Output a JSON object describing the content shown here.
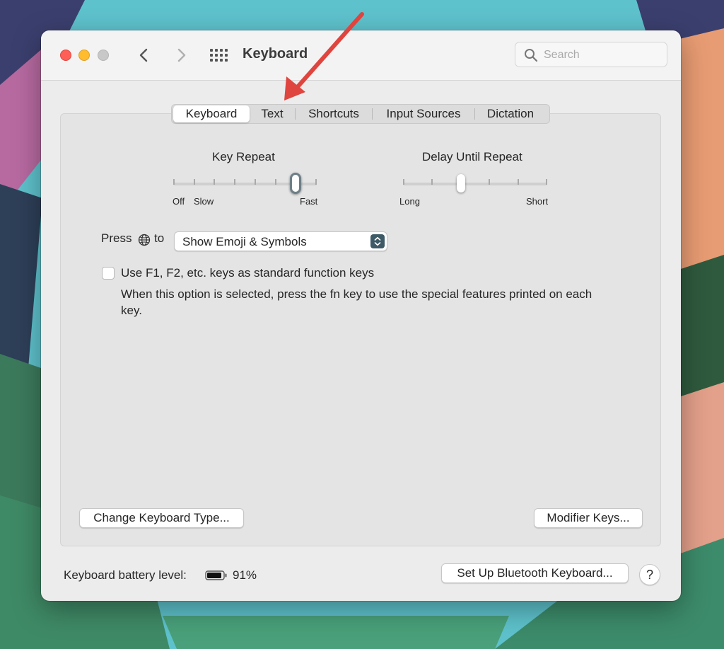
{
  "window": {
    "title": "Keyboard",
    "search_placeholder": "Search"
  },
  "tabs": [
    {
      "label": "Keyboard",
      "active": true
    },
    {
      "label": "Text",
      "active": false
    },
    {
      "label": "Shortcuts",
      "active": false
    },
    {
      "label": "Input Sources",
      "active": false
    },
    {
      "label": "Dictation",
      "active": false
    }
  ],
  "key_repeat": {
    "title": "Key Repeat",
    "label_off": "Off",
    "label_slow": "Slow",
    "label_fast": "Fast",
    "ticks": 8,
    "value_fraction": 0.85
  },
  "delay_until_repeat": {
    "title": "Delay Until Repeat",
    "label_long": "Long",
    "label_short": "Short",
    "ticks": 6,
    "value_fraction": 0.4
  },
  "press_globe": {
    "prefix": "Press",
    "suffix": "to",
    "selected_option": "Show Emoji & Symbols"
  },
  "function_keys": {
    "checked": false,
    "label": "Use F1, F2, etc. keys as standard function keys",
    "description": "When this option is selected, press the fn key to use the special features printed on each key."
  },
  "buttons": {
    "change_keyboard_type": "Change Keyboard Type...",
    "modifier_keys": "Modifier Keys...",
    "setup_bluetooth": "Set Up Bluetooth Keyboard...",
    "help": "?"
  },
  "battery": {
    "label": "Keyboard battery level:",
    "percent": "91%",
    "level_fraction": 0.91
  },
  "colors": {
    "close": "#fe5f57",
    "minimize": "#febc2e",
    "zoom": "#c8c8c8",
    "annotation_arrow": "#e0443e",
    "popup_button": "#3d5a66"
  }
}
